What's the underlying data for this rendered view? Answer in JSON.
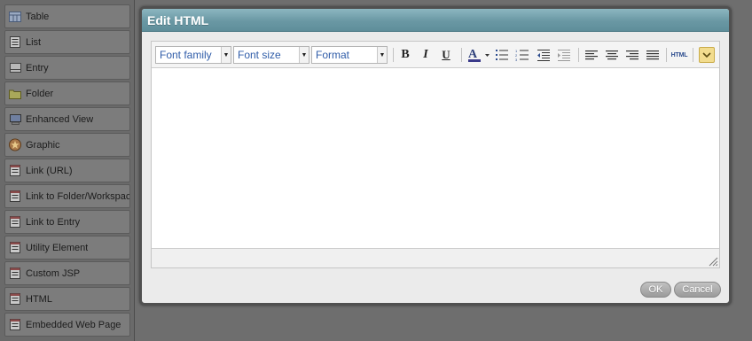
{
  "palette": {
    "items": [
      {
        "label": "Table",
        "icon": "table-icon"
      },
      {
        "label": "List",
        "icon": "list-icon"
      },
      {
        "label": "Entry",
        "icon": "entry-icon"
      },
      {
        "label": "Folder",
        "icon": "folder-icon"
      },
      {
        "label": "Enhanced View",
        "icon": "enhanced-view-icon"
      },
      {
        "label": "Graphic",
        "icon": "graphic-icon"
      },
      {
        "label": "Link (URL)",
        "icon": "link-url-icon"
      },
      {
        "label": "Link to Folder/Workspace",
        "icon": "link-folder-icon"
      },
      {
        "label": "Link to Entry",
        "icon": "link-entry-icon"
      },
      {
        "label": "Utility Element",
        "icon": "utility-element-icon"
      },
      {
        "label": "Custom JSP",
        "icon": "custom-jsp-icon"
      },
      {
        "label": "HTML",
        "icon": "html-element-icon"
      },
      {
        "label": "Embedded Web Page",
        "icon": "embedded-web-page-icon"
      }
    ]
  },
  "dialog": {
    "title": "Edit HTML",
    "toolbar": {
      "font_family": "Font family",
      "font_size": "Font size",
      "format": "Format",
      "bold": "B",
      "italic": "I",
      "underline": "U",
      "html": "HTML"
    },
    "ok_label": "OK",
    "cancel_label": "Cancel"
  },
  "colors": {
    "header_accent": "#6a98a4",
    "select_text": "#2f5ca8",
    "toggle_button": "#f2dc8e"
  }
}
